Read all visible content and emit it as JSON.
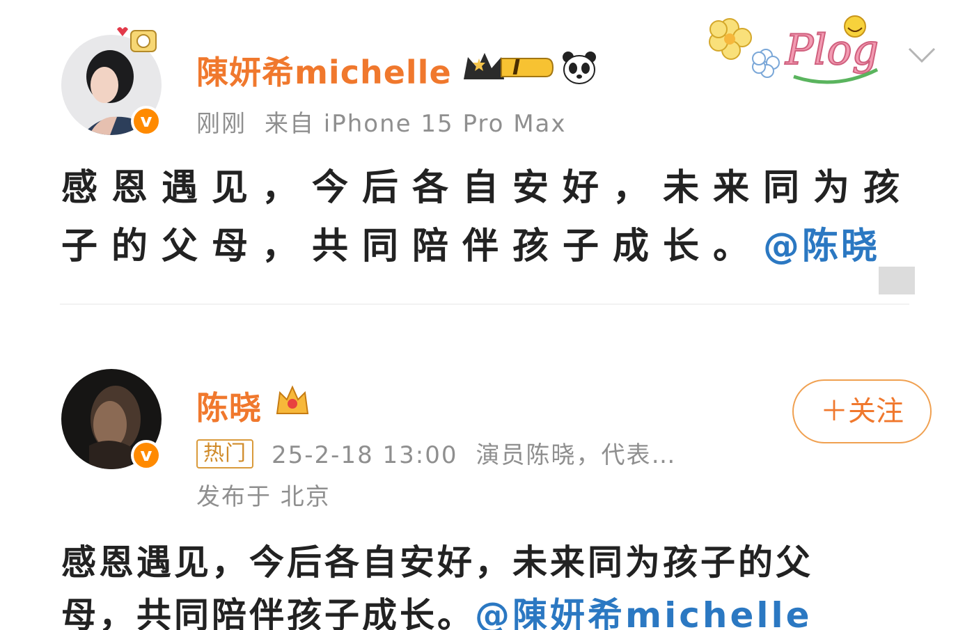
{
  "posts": [
    {
      "username": "陳妍希michelle",
      "time": "刚刚",
      "source": "来自 iPhone 15 Pro Max",
      "level_badge": "I",
      "sticker_text": "Plog",
      "text_main": "感恩遇见，今后各自安好，未来同为孩",
      "text_line2": "子的父母，共同陪伴孩子成长。",
      "mention": "@陈晓",
      "icons": [
        "crown-level-icon",
        "panda-icon",
        "chevron-down-icon",
        "verified-icon"
      ]
    },
    {
      "username": "陈晓",
      "hot_label": "热门",
      "time": "25-2-18 13:00",
      "desc": "演员陈晓，代表…",
      "location": "发布于 北京",
      "follow_label": "＋关注",
      "text_line1": "感恩遇见，今后各自安好，未来同为孩子的父",
      "text_line2": "母，共同陪伴孩子成长。",
      "mention": "@陳妍希michelle",
      "icons": [
        "crown-icon",
        "verified-icon"
      ]
    }
  ],
  "colors": {
    "username": "#f0782d",
    "mention": "#2b78c2",
    "meta": "#8f8f8f",
    "verified": "#ff8a00"
  }
}
